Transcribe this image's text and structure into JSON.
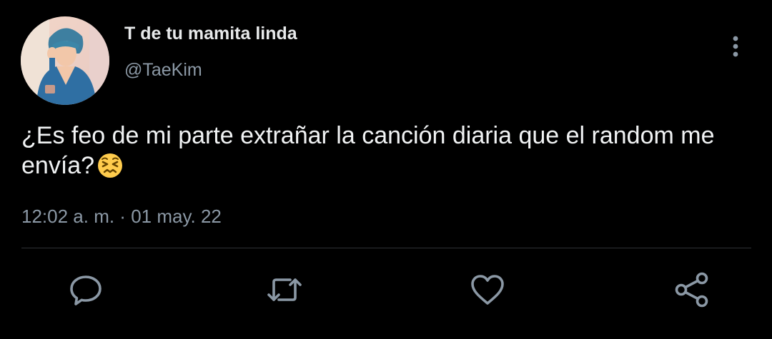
{
  "author": {
    "display_name": "T de tu mamita linda",
    "handle": "@TaeKim",
    "avatar": "avatar-photo"
  },
  "tweet": {
    "text": "¿Es feo de mi parte extrañar la canción diaria que el random me envía?",
    "emoji": "confounded-face-emoji",
    "time": "12:02 a. m.",
    "separator": " · ",
    "date": "01 may. 22"
  },
  "icons": {
    "more": "more-vertical-icon",
    "reply": "reply-icon",
    "retweet": "retweet-icon",
    "like": "heart-icon",
    "share": "share-icon"
  },
  "colors": {
    "background": "#000000",
    "primary_text": "#e7e9ea",
    "secondary_text": "#8b98a5",
    "divider": "#2f3336",
    "icon": "#8b98a5"
  }
}
